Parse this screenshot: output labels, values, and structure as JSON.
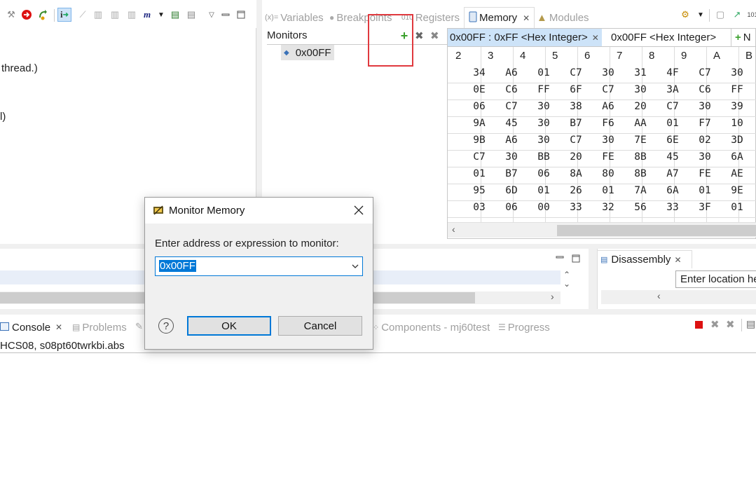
{
  "left_panel": {
    "text_thread": "thread.)",
    "text_paren": "l)"
  },
  "views_tabs": [
    {
      "label": "Variables"
    },
    {
      "label": "Breakpoints"
    },
    {
      "label": "Registers"
    },
    {
      "label": "Memory"
    },
    {
      "label": "Modules"
    }
  ],
  "monitors": {
    "title": "Monitors",
    "item": "0x00FF"
  },
  "renderings": {
    "tab1": "0x00FF : 0xFF <Hex Integer>",
    "tab2": "0x00FF <Hex Integer>",
    "tab3": "N"
  },
  "memory": {
    "columns": [
      "2",
      "3",
      "4",
      "5",
      "6",
      "7",
      "8",
      "9",
      "A",
      "B"
    ],
    "rows": [
      [
        "34",
        "A6",
        "01",
        "C7",
        "30",
        "31",
        "4F",
        "C7",
        "30"
      ],
      [
        "0E",
        "C6",
        "FF",
        "6F",
        "C7",
        "30",
        "3A",
        "C6",
        "FF"
      ],
      [
        "06",
        "C7",
        "30",
        "38",
        "A6",
        "20",
        "C7",
        "30",
        "39"
      ],
      [
        "9A",
        "45",
        "30",
        "B7",
        "F6",
        "AA",
        "01",
        "F7",
        "10"
      ],
      [
        "9B",
        "A6",
        "30",
        "C7",
        "30",
        "7E",
        "6E",
        "02",
        "3D"
      ],
      [
        "C7",
        "30",
        "BB",
        "20",
        "FE",
        "8B",
        "45",
        "30",
        "6A"
      ],
      [
        "01",
        "B7",
        "06",
        "8A",
        "80",
        "8B",
        "A7",
        "FE",
        "AE"
      ],
      [
        "95",
        "6D",
        "01",
        "26",
        "01",
        "7A",
        "6A",
        "01",
        "9E"
      ],
      [
        "03",
        "06",
        "00",
        "33",
        "32",
        "56",
        "33",
        "3F",
        "01"
      ]
    ]
  },
  "disassembly": {
    "tab": "Disassembly",
    "location_placeholder": "Enter location he"
  },
  "bottom_tabs": {
    "console": "Console",
    "problems": "Problems",
    "components": "Components - mj60test",
    "progress": "Progress"
  },
  "console": {
    "line": "HCS08, s08pt60twrkbi.abs"
  },
  "dialog": {
    "title": "Monitor Memory",
    "label": "Enter address or expression to monitor:",
    "value": "0x00FF",
    "ok": "OK",
    "cancel": "Cancel",
    "help_glyph": "?"
  },
  "colors": {
    "highlight": "#e0393e",
    "selection": "#0078d7",
    "tab_active": "#cde3f8"
  }
}
